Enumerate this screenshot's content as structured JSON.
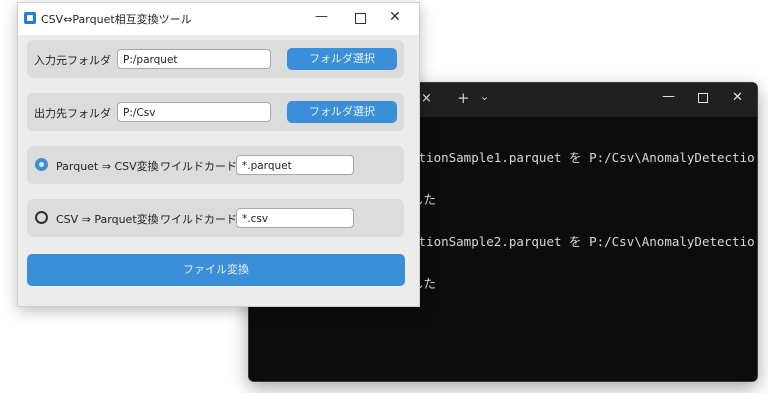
{
  "terminal": {
    "tab_close": "×",
    "new_tab": "+",
    "dropdown": "⌄",
    "minimize": "—",
    "close": "✕",
    "lines": [
      "ctionSample1.parquet を P:/Csv\\AnomalyDetectio",
      "した",
      "ctionSample2.parquet を P:/Csv\\AnomalyDetectio",
      "した"
    ]
  },
  "app": {
    "title": "CSV⇔Parquet相互変換ツール",
    "controls": {
      "minimize": "—",
      "close": "✕"
    },
    "input_folder": {
      "label": "入力元フォルダ",
      "value": "P:/parquet",
      "button": "フォルダ選択"
    },
    "output_folder": {
      "label": "出力先フォルダ",
      "value": "P:/Csv",
      "button": "フォルダ選択"
    },
    "mode_parquet_to_csv": {
      "label": "Parquet ⇒ CSV変換",
      "wildcard_label": "ワイルドカード",
      "wildcard": "*.parquet",
      "selected": true
    },
    "mode_csv_to_parquet": {
      "label": "CSV ⇒ Parquet変換",
      "wildcard_label": "ワイルドカード",
      "wildcard": "*.csv",
      "selected": false
    },
    "convert_button": "ファイル変換"
  }
}
